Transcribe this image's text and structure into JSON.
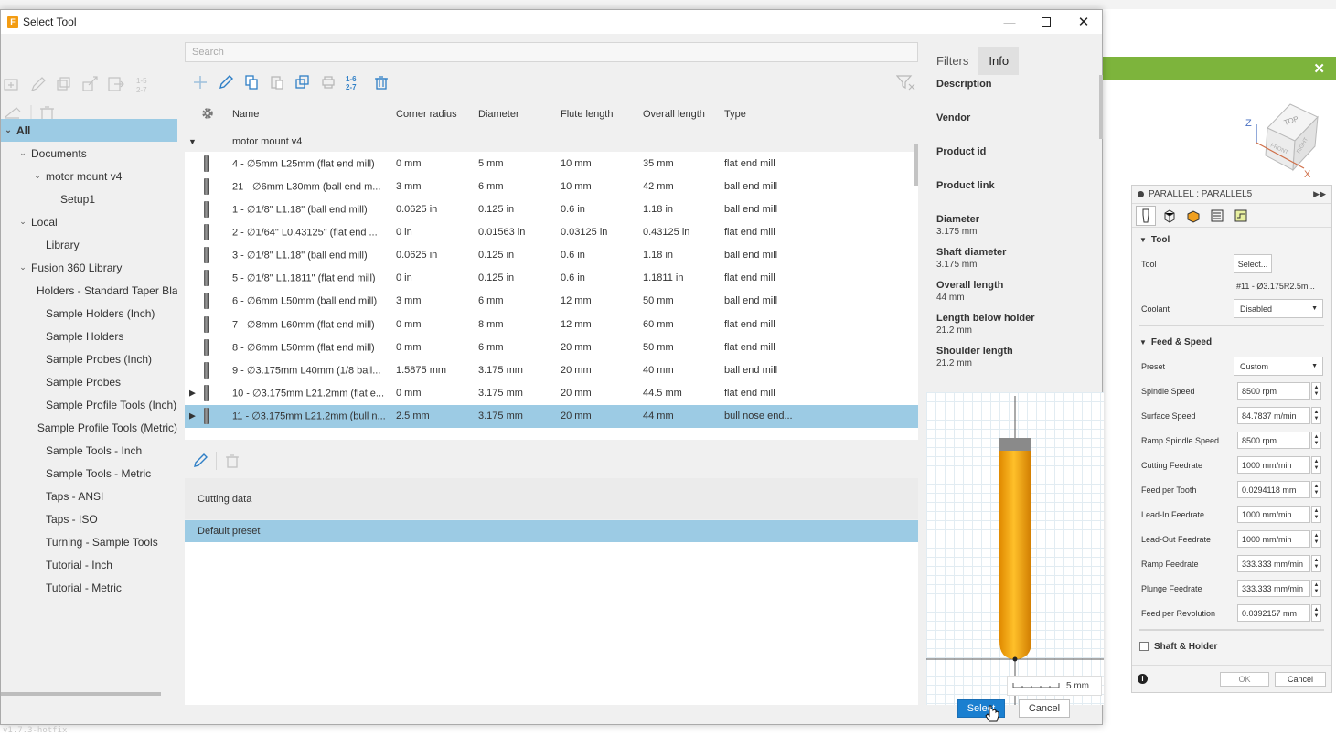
{
  "dialog": {
    "title": "Select Tool",
    "app_icon_letter": "F",
    "search_placeholder": "Search",
    "select_label": "Select",
    "cancel_label": "Cancel",
    "version_text": "v1.7.3-hotfix"
  },
  "tree": {
    "items": [
      {
        "label": "All",
        "level": 0,
        "expanded": true,
        "selected": true
      },
      {
        "label": "Documents",
        "level": 1,
        "expanded": true
      },
      {
        "label": "motor mount v4",
        "level": 2,
        "expanded": true
      },
      {
        "label": "Setup1",
        "level": 3
      },
      {
        "label": "Local",
        "level": 1,
        "expanded": true
      },
      {
        "label": "Library",
        "level": 2
      },
      {
        "label": "Fusion 360 Library",
        "level": 1,
        "expanded": true
      },
      {
        "label": "Holders - Standard Taper Blanks",
        "level": 2
      },
      {
        "label": "Sample Holders (Inch)",
        "level": 2
      },
      {
        "label": "Sample Holders",
        "level": 2
      },
      {
        "label": "Sample Probes (Inch)",
        "level": 2
      },
      {
        "label": "Sample Probes",
        "level": 2
      },
      {
        "label": "Sample Profile Tools (Inch)",
        "level": 2
      },
      {
        "label": "Sample Profile Tools (Metric)",
        "level": 2
      },
      {
        "label": "Sample Tools - Inch",
        "level": 2
      },
      {
        "label": "Sample Tools - Metric",
        "level": 2
      },
      {
        "label": "Taps - ANSI",
        "level": 2
      },
      {
        "label": "Taps - ISO",
        "level": 2
      },
      {
        "label": "Turning - Sample Tools",
        "level": 2
      },
      {
        "label": "Tutorial - Inch",
        "level": 2
      },
      {
        "label": "Tutorial - Metric",
        "level": 2
      }
    ]
  },
  "table": {
    "columns": [
      "Name",
      "Corner radius",
      "Diameter",
      "Flute length",
      "Overall length",
      "Type"
    ],
    "group_label": "motor mount v4",
    "rows": [
      {
        "name": "4 - ∅5mm L25mm (flat end mill)",
        "corner": "0 mm",
        "diameter": "5 mm",
        "flute": "10 mm",
        "overall": "35 mm",
        "type": "flat end mill"
      },
      {
        "name": "21 - ∅6mm L30mm (ball end m...",
        "corner": "3 mm",
        "diameter": "6 mm",
        "flute": "10 mm",
        "overall": "42 mm",
        "type": "ball end mill"
      },
      {
        "name": "1 - ∅1/8\" L1.18\" (ball end mill)",
        "corner": "0.0625 in",
        "diameter": "0.125 in",
        "flute": "0.6 in",
        "overall": "1.18 in",
        "type": "ball end mill"
      },
      {
        "name": "2 - ∅1/64\" L0.43125\" (flat end ...",
        "corner": "0 in",
        "diameter": "0.01563 in",
        "flute": "0.03125 in",
        "overall": "0.43125 in",
        "type": "flat end mill"
      },
      {
        "name": "3 - ∅1/8\" L1.18\" (ball end mill)",
        "corner": "0.0625 in",
        "diameter": "0.125 in",
        "flute": "0.6 in",
        "overall": "1.18 in",
        "type": "ball end mill"
      },
      {
        "name": "5 - ∅1/8\" L1.1811\" (flat end mill)",
        "corner": "0 in",
        "diameter": "0.125 in",
        "flute": "0.6 in",
        "overall": "1.1811 in",
        "type": "flat end mill"
      },
      {
        "name": "6 - ∅6mm L50mm (ball end mill)",
        "corner": "3 mm",
        "diameter": "6 mm",
        "flute": "12 mm",
        "overall": "50 mm",
        "type": "ball end mill"
      },
      {
        "name": "7 - ∅8mm L60mm (flat end mill)",
        "corner": "0 mm",
        "diameter": "8 mm",
        "flute": "12 mm",
        "overall": "60 mm",
        "type": "flat end mill"
      },
      {
        "name": "8 - ∅6mm L50mm (flat end mill)",
        "corner": "0 mm",
        "diameter": "6 mm",
        "flute": "20 mm",
        "overall": "50 mm",
        "type": "flat end mill"
      },
      {
        "name": "9 - ∅3.175mm L40mm (1/8 ball...",
        "corner": "1.5875 mm",
        "diameter": "3.175 mm",
        "flute": "20 mm",
        "overall": "40 mm",
        "type": "ball end mill"
      },
      {
        "name": "10 - ∅3.175mm L21.2mm (flat e...",
        "corner": "0 mm",
        "diameter": "3.175 mm",
        "flute": "20 mm",
        "overall": "44.5 mm",
        "type": "flat end mill",
        "has_children": true
      },
      {
        "name": "11 - ∅3.175mm L21.2mm (bull n...",
        "corner": "2.5 mm",
        "diameter": "3.175 mm",
        "flute": "20 mm",
        "overall": "44 mm",
        "type": "bull nose end...",
        "has_children": true,
        "selected": true
      }
    ]
  },
  "cutting": {
    "title": "Cutting data",
    "preset": "Default preset"
  },
  "info": {
    "tabs": [
      "Filters",
      "Info"
    ],
    "active_tab": "Info",
    "fields": [
      {
        "key": "Description",
        "value": ""
      },
      {
        "key": "Vendor",
        "value": ""
      },
      {
        "key": "Product id",
        "value": ""
      },
      {
        "key": "Product link",
        "value": ""
      },
      {
        "key": "Diameter",
        "value": "3.175 mm"
      },
      {
        "key": "Shaft diameter",
        "value": "3.175 mm"
      },
      {
        "key": "Overall length",
        "value": "44 mm"
      },
      {
        "key": "Length below holder",
        "value": "21.2 mm"
      },
      {
        "key": "Shoulder length",
        "value": "21.2 mm"
      }
    ],
    "scale_label": "5 mm"
  },
  "parallel": {
    "header": "PARALLEL : PARALLEL5",
    "tool_section": "Tool",
    "tool_label": "Tool",
    "tool_button": "Select...",
    "tool_name": "#11 - Ø3.175R2.5m...",
    "coolant_label": "Coolant",
    "coolant_value": "Disabled",
    "feed_section": "Feed & Speed",
    "preset_label": "Preset",
    "preset_value": "Custom",
    "fields": [
      {
        "label": "Spindle Speed",
        "value": "8500 rpm"
      },
      {
        "label": "Surface Speed",
        "value": "84.7837 m/min"
      },
      {
        "label": "Ramp Spindle Speed",
        "value": "8500 rpm"
      },
      {
        "label": "Cutting Feedrate",
        "value": "1000 mm/min"
      },
      {
        "label": "Feed per Tooth",
        "value": "0.0294118 mm"
      },
      {
        "label": "Lead-In Feedrate",
        "value": "1000 mm/min"
      },
      {
        "label": "Lead-Out Feedrate",
        "value": "1000 mm/min"
      },
      {
        "label": "Ramp Feedrate",
        "value": "333.333 mm/min"
      },
      {
        "label": "Plunge Feedrate",
        "value": "333.333 mm/min"
      },
      {
        "label": "Feed per Revolution",
        "value": "0.0392157 mm"
      }
    ],
    "shaft_section": "Shaft & Holder",
    "ok_label": "OK",
    "cancel_label": "Cancel"
  },
  "viewcube": {
    "top": "TOP",
    "front": "FRONT",
    "right": "RIGHT",
    "z": "Z",
    "x": "X"
  },
  "colors": {
    "selection": "#9ccbe4",
    "primary_button": "#1a7fd0",
    "accent_green": "#7db43c",
    "tool_yellow": "#f5b800"
  }
}
